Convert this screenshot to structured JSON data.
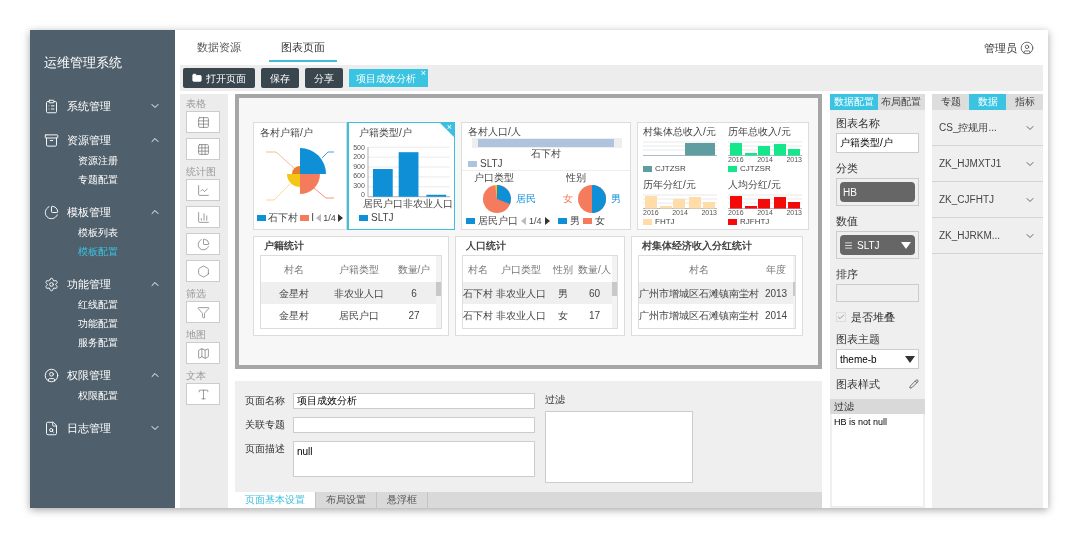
{
  "sidebar": {
    "title": "运维管理系统",
    "groups": [
      {
        "label": "系统管理",
        "expanded": false
      },
      {
        "label": "资源管理",
        "expanded": true,
        "children": [
          {
            "label": "资源注册",
            "selected": false
          },
          {
            "label": "专题配置",
            "selected": false
          }
        ]
      },
      {
        "label": "模板管理",
        "expanded": true,
        "children": [
          {
            "label": "模板列表",
            "selected": false
          },
          {
            "label": "模板配置",
            "selected": true
          }
        ]
      },
      {
        "label": "功能管理",
        "expanded": true,
        "children": [
          {
            "label": "红线配置",
            "selected": false
          },
          {
            "label": "功能配置",
            "selected": false
          },
          {
            "label": "服务配置",
            "selected": false
          }
        ]
      },
      {
        "label": "权限管理",
        "expanded": true,
        "children": [
          {
            "label": "权限配置",
            "selected": false
          }
        ]
      },
      {
        "label": "日志管理",
        "expanded": false
      }
    ]
  },
  "header": {
    "tabs": [
      {
        "label": "数据资源",
        "selected": false
      },
      {
        "label": "图表页面",
        "selected": true
      }
    ],
    "user": "管理员"
  },
  "toolbar": {
    "buttons": [
      "打开页面",
      "保存",
      "分享"
    ],
    "open_tab": {
      "label": "项目成效分析",
      "close": "×"
    }
  },
  "palette": [
    "表格",
    "统计图",
    "筛选",
    "地图",
    "文本"
  ],
  "canvas": {
    "widgets": [
      {
        "kind": "rose",
        "title": "各村户籍/户",
        "selected": false,
        "legend": [
          {
            "label": "石下村",
            "color": "#0e8fd6"
          },
          {
            "label": "I",
            "color": "#f47c5c"
          }
        ],
        "pager": "1/4"
      },
      {
        "kind": "bar",
        "title": "户籍类型/户",
        "selected": true,
        "close": "×",
        "yticks": [
          "500",
          "200",
          "900",
          "600",
          "300",
          "0"
        ],
        "categories": [
          "居民户口",
          "非农业人口"
        ],
        "legend": [
          {
            "label": "SLTJ",
            "color": "#0e8fd6"
          }
        ]
      },
      {
        "kind": "group",
        "title": "各村人口/人",
        "selected": false,
        "axis_label": "石下村",
        "legend": [
          {
            "label": "SLTJ",
            "color": "#aec3de"
          }
        ],
        "pies": [
          {
            "title": "户口类型",
            "labels": [
              "居民"
            ],
            "legend": [
              {
                "label": "居民户口",
                "color": "#0e8fd6"
              }
            ],
            "pager": "1/4"
          },
          {
            "title": "性别",
            "labels": [
              "女",
              "男"
            ],
            "legend": [
              {
                "label": "男",
                "color": "#0e8fd6"
              },
              {
                "label": "女",
                "color": "#f47c5c"
              }
            ]
          }
        ]
      },
      {
        "kind": "minis",
        "selected": false,
        "charts": [
          {
            "title": "村集体总收入/元",
            "color": "#5f9ea0",
            "legend": "CJTZSR"
          },
          {
            "title": "历年总收入/元",
            "color": "#14e68a",
            "legend": "CJTZSR",
            "xlabels": [
              "2016",
              "2014",
              "2013"
            ]
          },
          {
            "title": "历年分红/元",
            "color": "#ffdca8",
            "legend": "FHTJ",
            "xlabels": [
              "2016",
              "2014",
              "2013"
            ]
          },
          {
            "title": "人均分红/元",
            "color": "#f50a0a",
            "legend": "RJFHTJ",
            "xlabels": [
              "2016",
              "2014",
              "2013"
            ]
          }
        ]
      }
    ],
    "tables": [
      {
        "title": "户籍统计",
        "columns": [
          "村名",
          "户籍类型",
          "数量/户"
        ],
        "rows": [
          [
            "金星村",
            "非农业人口",
            "6"
          ],
          [
            "金星村",
            "居民户口",
            "27"
          ]
        ]
      },
      {
        "title": "人口统计",
        "columns": [
          "村名",
          "户口类型",
          "性别",
          "数量/人"
        ],
        "rows": [
          [
            "石下村",
            "非农业人口",
            "男",
            "60"
          ],
          [
            "石下村",
            "非农业人口",
            "女",
            "17"
          ]
        ]
      },
      {
        "title": "村集体经济收入分红统计",
        "columns": [
          "村名",
          "年度"
        ],
        "rows": [
          [
            "广州市增城区石滩镇南坣村",
            "2013"
          ],
          [
            "广州市增城区石滩镇南坣村",
            "2014"
          ]
        ]
      }
    ]
  },
  "form": {
    "fields": [
      {
        "label": "页面名称",
        "kind": "input",
        "value": "项目成效分析"
      },
      {
        "label": "关联专题",
        "kind": "input"
      },
      {
        "label": "页面描述",
        "kind": "textarea",
        "value": "null"
      }
    ],
    "filter_label": "过滤",
    "tabs": [
      {
        "label": "页面基本设置",
        "selected": true
      },
      {
        "label": "布局设置",
        "selected": false
      },
      {
        "label": "悬浮框",
        "selected": false
      }
    ]
  },
  "config": {
    "tabs": [
      {
        "label": "数据配置",
        "selected": true
      },
      {
        "label": "布局配置",
        "selected": false
      }
    ],
    "items": [
      {
        "kind": "input",
        "label": "图表名称",
        "value": "户籍类型/户"
      },
      {
        "kind": "chip",
        "label": "分类",
        "value": "HB"
      },
      {
        "kind": "dropchip",
        "label": "数值",
        "value": "SLTJ"
      },
      {
        "kind": "empty",
        "label": "排序"
      },
      {
        "kind": "checkbox",
        "label": "是否堆叠",
        "checked": true
      },
      {
        "kind": "select",
        "label": "图表主题",
        "value": "theme-b"
      },
      {
        "kind": "style",
        "label": "图表样式"
      },
      {
        "kind": "filter",
        "label": "过滤",
        "value": "HB is not null"
      }
    ]
  },
  "datasets": {
    "tabs": [
      {
        "label": "专题",
        "selected": false
      },
      {
        "label": "数据",
        "selected": true
      },
      {
        "label": "指标",
        "selected": false
      }
    ],
    "items": [
      "CS_控规用...",
      "ZK_HJMXTJ1",
      "ZK_CJFHTJ",
      "ZK_HJRKM..."
    ]
  }
}
